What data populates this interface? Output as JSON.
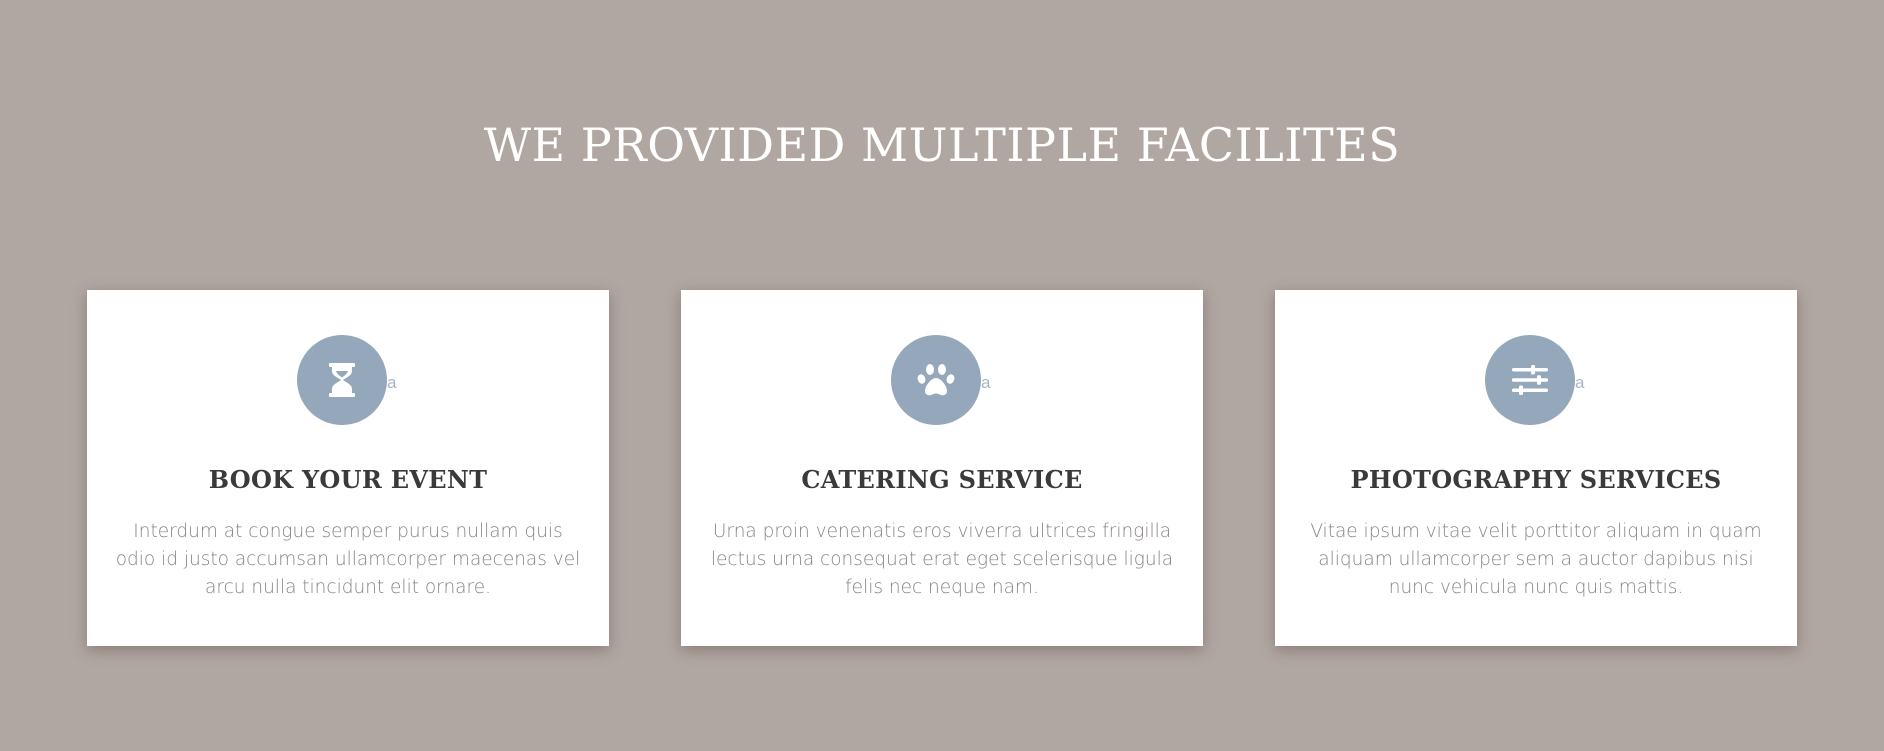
{
  "section": {
    "title": "WE PROVIDED MULTIPLE FACILITES"
  },
  "cards": [
    {
      "icon": "hourglass-icon",
      "icon_suffix": "a",
      "title": "BOOK YOUR EVENT",
      "text": "Interdum at congue semper purus nullam quis odio id justo accumsan ullamcorper maecenas vel arcu nulla tincidunt elit ornare."
    },
    {
      "icon": "paw-icon",
      "icon_suffix": "a",
      "title": "CATERING SERVICE",
      "text": "Urna proin venenatis eros viverra ultrices fringilla lectus urna consequat erat eget scelerisque ligula felis nec neque nam."
    },
    {
      "icon": "sliders-icon",
      "icon_suffix": "a",
      "title": "PHOTOGRAPHY SERVICES",
      "text": "Vitae ipsum vitae velit porttitor aliquam in quam aliquam ullamcorper sem a auctor dapibus nisi nunc vehicula nunc quis mattis."
    }
  ],
  "colors": {
    "background": "#b1a7a2",
    "card": "#ffffff",
    "icon_circle": "#94a7bb",
    "heading": "#3a3a3a",
    "body_text": "#8a8482"
  }
}
